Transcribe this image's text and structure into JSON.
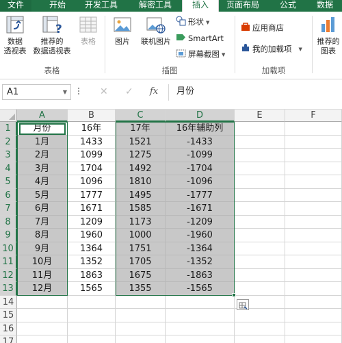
{
  "ribbon_tabs": [
    {
      "label": "文件",
      "active": false
    },
    {
      "label": "开始",
      "active": false
    },
    {
      "label": "开发工具",
      "active": false
    },
    {
      "label": "解密工具",
      "active": false
    },
    {
      "label": "插入",
      "active": true
    },
    {
      "label": "页面布局",
      "active": false
    },
    {
      "label": "公式",
      "active": false
    },
    {
      "label": "数据",
      "active": false
    }
  ],
  "ribbon": {
    "tables": {
      "pivot_line1": "数据",
      "pivot_line2": "透视表",
      "recommended_pivot_line1": "推荐的",
      "recommended_pivot_line2": "数据透视表",
      "table": "表格",
      "group_label": "表格"
    },
    "illustrations": {
      "pictures": "图片",
      "online_pictures": "联机图片",
      "shapes": "形状",
      "smartart": "SmartArt",
      "screenshot": "屏幕截图",
      "group_label": "插图"
    },
    "addins": {
      "store": "应用商店",
      "my_addins": "我的加载项",
      "group_label": "加载项"
    },
    "charts": {
      "recommended_line1": "推荐的",
      "recommended_line2": "图表"
    }
  },
  "formula_bar": {
    "name_box": "A1",
    "fx": "fx",
    "content": "月份"
  },
  "sheet": {
    "columns": [
      "A",
      "B",
      "C",
      "D",
      "E",
      "F"
    ],
    "row_numbers": [
      "1",
      "2",
      "3",
      "4",
      "5",
      "6",
      "7",
      "8",
      "9",
      "10",
      "11",
      "12",
      "13",
      "14",
      "15",
      "16",
      "17"
    ],
    "rows": [
      [
        "月份",
        "16年",
        "17年",
        "16年辅助列"
      ],
      [
        "1月",
        "1433",
        "1521",
        "-1433"
      ],
      [
        "2月",
        "1099",
        "1275",
        "-1099"
      ],
      [
        "3月",
        "1704",
        "1492",
        "-1704"
      ],
      [
        "4月",
        "1096",
        "1810",
        "-1096"
      ],
      [
        "5月",
        "1777",
        "1495",
        "-1777"
      ],
      [
        "6月",
        "1671",
        "1585",
        "-1671"
      ],
      [
        "7月",
        "1209",
        "1173",
        "-1209"
      ],
      [
        "8月",
        "1960",
        "1000",
        "-1960"
      ],
      [
        "9月",
        "1364",
        "1751",
        "-1364"
      ],
      [
        "10月",
        "1352",
        "1705",
        "-1352"
      ],
      [
        "11月",
        "1863",
        "1675",
        "-1863"
      ],
      [
        "12月",
        "1565",
        "1355",
        "-1565"
      ]
    ]
  },
  "colors": {
    "accent": "#217346",
    "selection_fill": "#c8c8c8",
    "addin_store": "#d83b01",
    "addin_my": "#2b579a"
  }
}
